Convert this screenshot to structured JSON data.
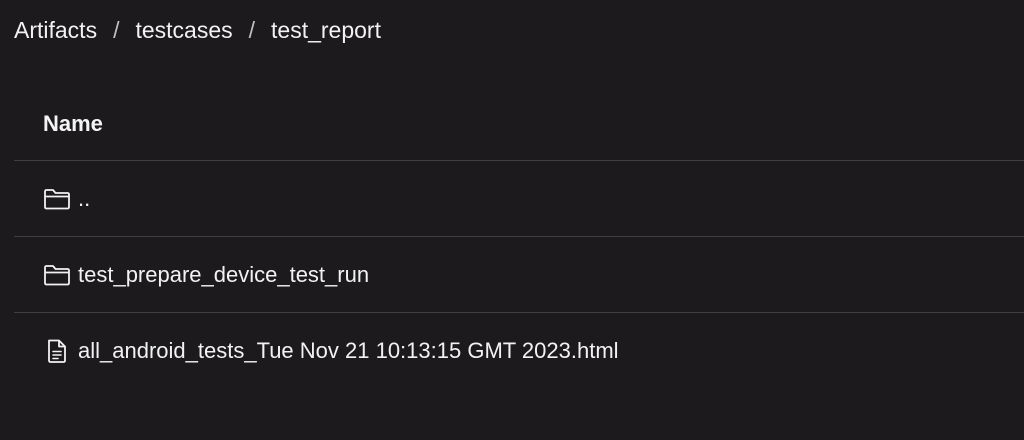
{
  "breadcrumb": {
    "items": [
      {
        "label": "Artifacts"
      },
      {
        "label": "testcases"
      },
      {
        "label": "test_report"
      }
    ],
    "separator": "/"
  },
  "table": {
    "header": {
      "name": "Name"
    },
    "rows": [
      {
        "label": "..",
        "icon": "folder-icon"
      },
      {
        "label": "test_prepare_device_test_run",
        "icon": "folder-icon"
      },
      {
        "label": "all_android_tests_Tue Nov 21 10:13:15 GMT 2023.html",
        "icon": "file-icon"
      }
    ]
  },
  "colors": {
    "background": "#1c1a1d",
    "text": "#f2f2f4",
    "divider": "#3f3d42"
  }
}
